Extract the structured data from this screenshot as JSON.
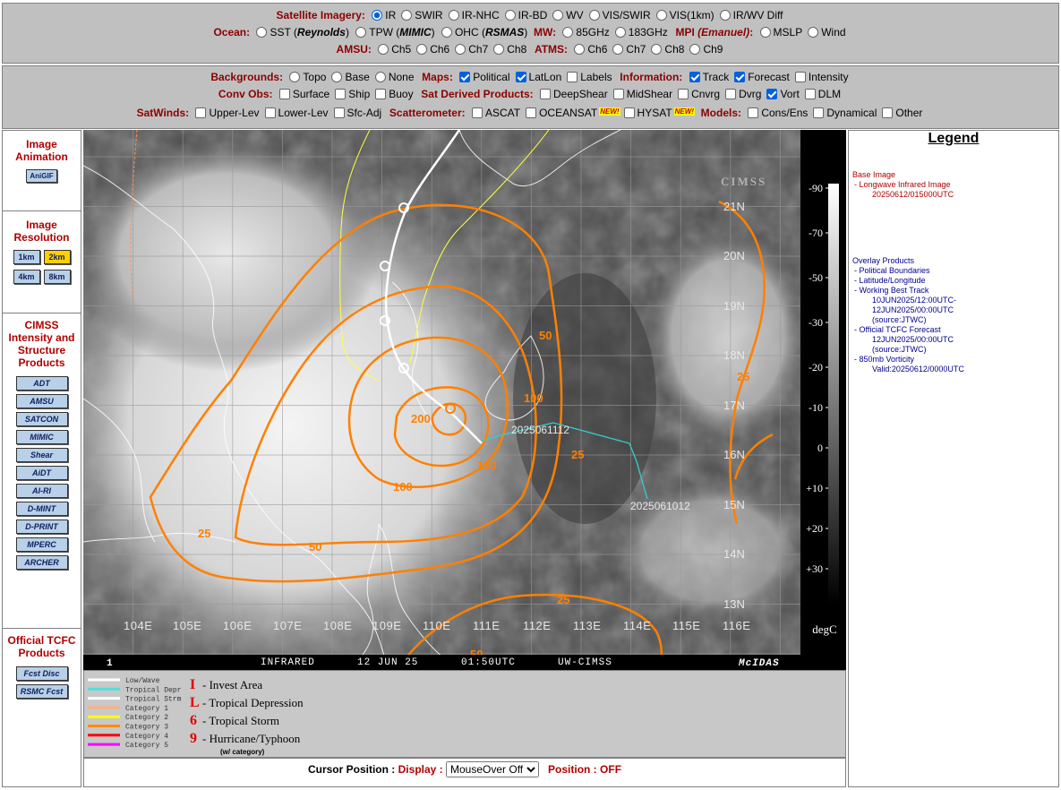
{
  "sat": {
    "line1_label": "Satellite Imagery:",
    "line1": [
      {
        "label": "IR",
        "on": true
      },
      {
        "label": "SWIR",
        "on": false
      },
      {
        "label": "IR-NHC",
        "on": false
      },
      {
        "label": "IR-BD",
        "on": false
      },
      {
        "label": "WV",
        "on": false
      },
      {
        "label": "VIS/SWIR",
        "on": false
      },
      {
        "label": "VIS(1km)",
        "on": false
      },
      {
        "label": "IR/WV Diff",
        "on": false
      }
    ],
    "ocean_label": "Ocean:",
    "sst_pre": "SST (",
    "sst_em": "Reynolds",
    "sst_post": ")",
    "tpw_pre": "TPW (",
    "tpw_em": "MIMIC",
    "tpw_post": ")",
    "ohc_pre": "OHC (",
    "ohc_em": "RSMAS",
    "ohc_post": ")",
    "mw_label": "MW:",
    "mw": [
      "85GHz",
      "183GHz"
    ],
    "mpi_label": "MPI",
    "mpi_em": "(Emanuel)",
    "mpi_colon": ":",
    "mpi": [
      "MSLP",
      "Wind"
    ],
    "amsu_label": "AMSU:",
    "amsu": [
      "Ch5",
      "Ch6",
      "Ch7",
      "Ch8"
    ],
    "atms_label": "ATMS:",
    "atms": [
      "Ch6",
      "Ch7",
      "Ch8",
      "Ch9"
    ]
  },
  "overlay": {
    "bg_label": "Backgrounds:",
    "bg": [
      "Topo",
      "Base",
      "None"
    ],
    "maps_label": "Maps:",
    "maps": [
      {
        "label": "Political",
        "on": true
      },
      {
        "label": "LatLon",
        "on": true
      },
      {
        "label": "Labels",
        "on": false
      }
    ],
    "info_label": "Information:",
    "info": [
      {
        "label": "Track",
        "on": true
      },
      {
        "label": "Forecast",
        "on": true
      },
      {
        "label": "Intensity",
        "on": false
      }
    ],
    "conv_label": "Conv Obs:",
    "conv": [
      "Surface",
      "Ship",
      "Buoy"
    ],
    "sdp_label": "Sat Derived Products:",
    "sdp": [
      {
        "label": "DeepShear",
        "on": false
      },
      {
        "label": "MidShear",
        "on": false
      },
      {
        "label": "Cnvrg",
        "on": false
      },
      {
        "label": "Dvrg",
        "on": false
      },
      {
        "label": "Vort",
        "on": true
      },
      {
        "label": "DLM",
        "on": false
      }
    ],
    "satwinds_label": "SatWinds:",
    "satwinds": [
      "Upper-Lev",
      "Lower-Lev",
      "Sfc-Adj"
    ],
    "scat_label": "Scatterometer:",
    "scat": [
      "ASCAT",
      "OCEANSAT",
      "HYSAT"
    ],
    "new_tag": "NEW!",
    "models_label": "Models:",
    "models": [
      "Cons/Ens",
      "Dynamical",
      "Other"
    ]
  },
  "left": {
    "anim_title": "Image Animation",
    "anim_btn": "AniGIF",
    "res_title": "Image Resolution",
    "res": [
      {
        "label": "1km",
        "sel": false
      },
      {
        "label": "2km",
        "sel": true
      },
      {
        "label": "4km",
        "sel": false
      },
      {
        "label": "8km",
        "sel": false
      }
    ],
    "cimss_title": "CIMSS Intensity and Structure Products",
    "cimss": [
      "ADT",
      "AMSU",
      "SATCON",
      "MIMIC",
      "Shear",
      "AiDT",
      "AI-RI",
      "D-MINT",
      "D-PRINT",
      "MPERC",
      "ARCHER"
    ],
    "tcfc_title": "Official TCFC Products",
    "tcfc": [
      "Fcst Disc",
      "RSMC Fcst"
    ]
  },
  "map": {
    "lat_labels": [
      "21N",
      "20N",
      "19N",
      "18N",
      "17N",
      "16N",
      "15N",
      "14N",
      "13N"
    ],
    "lon_labels": [
      "104E",
      "105E",
      "106E",
      "107E",
      "108E",
      "109E",
      "110E",
      "111E",
      "112E",
      "113E",
      "114E",
      "115E",
      "116E"
    ],
    "contours": [
      "25",
      "50",
      "100",
      "150",
      "200",
      "100",
      "50",
      "25",
      "25",
      "25",
      "50"
    ],
    "track_labels": [
      "2025061112",
      "2025061012"
    ],
    "footer": {
      "frame": "1",
      "channel": "INFRARED",
      "date": "12 JUN 25",
      "time": "01:50UTC",
      "source": "UW-CIMSS",
      "brand": "McIDAS"
    },
    "watermark": "CIMSS"
  },
  "colorbar": {
    "ticks": [
      "-90",
      "-70",
      "-50",
      "-30",
      "-20",
      "-10",
      "0",
      "+10",
      "+20",
      "+30"
    ],
    "unit": "degC"
  },
  "legend": {
    "title": "Legend",
    "base_head": "Base Image",
    "base_item": "- Longwave Infrared Image",
    "base_time": "20250612/015000UTC",
    "overlay_head": "Overlay Products",
    "items": [
      "- Political Boundaries",
      "- Latitude/Longitude",
      "- Working Best Track",
      "10JUN2025/12:00UTC-",
      "12JUN2025/00:00UTC",
      "(source:JTWC)",
      "- Official TCFC Forecast",
      "12JUN2025/00:00UTC",
      "(source:JTWC)",
      "- 850mb Vorticity",
      "Valid:20250612/0000UTC"
    ]
  },
  "key": {
    "lines": [
      "Low/Wave",
      "Tropical Depr",
      "Tropical Strm",
      "Category 1",
      "Category 2",
      "Category 3",
      "Category 4",
      "Category 5"
    ],
    "line_colors": [
      "#ffffff",
      "#4fe0e0",
      "#ffffff",
      "#ffb080",
      "#ffff00",
      "#ff8c00",
      "#ff0000",
      "#ff00ff"
    ],
    "symbols": [
      {
        "glyph": "I",
        "label": "- Invest Area"
      },
      {
        "glyph": "L",
        "label": "- Tropical Depression"
      },
      {
        "glyph": "6",
        "label": "- Tropical Storm"
      },
      {
        "glyph": "9",
        "label": "- Hurricane/Typhoon"
      }
    ],
    "note": "(w/ category)"
  },
  "cursor": {
    "label": "Cursor Position :",
    "display_label": "Display :",
    "select_value": "MouseOver Off",
    "position_label": "Position :",
    "position_value": "OFF"
  }
}
